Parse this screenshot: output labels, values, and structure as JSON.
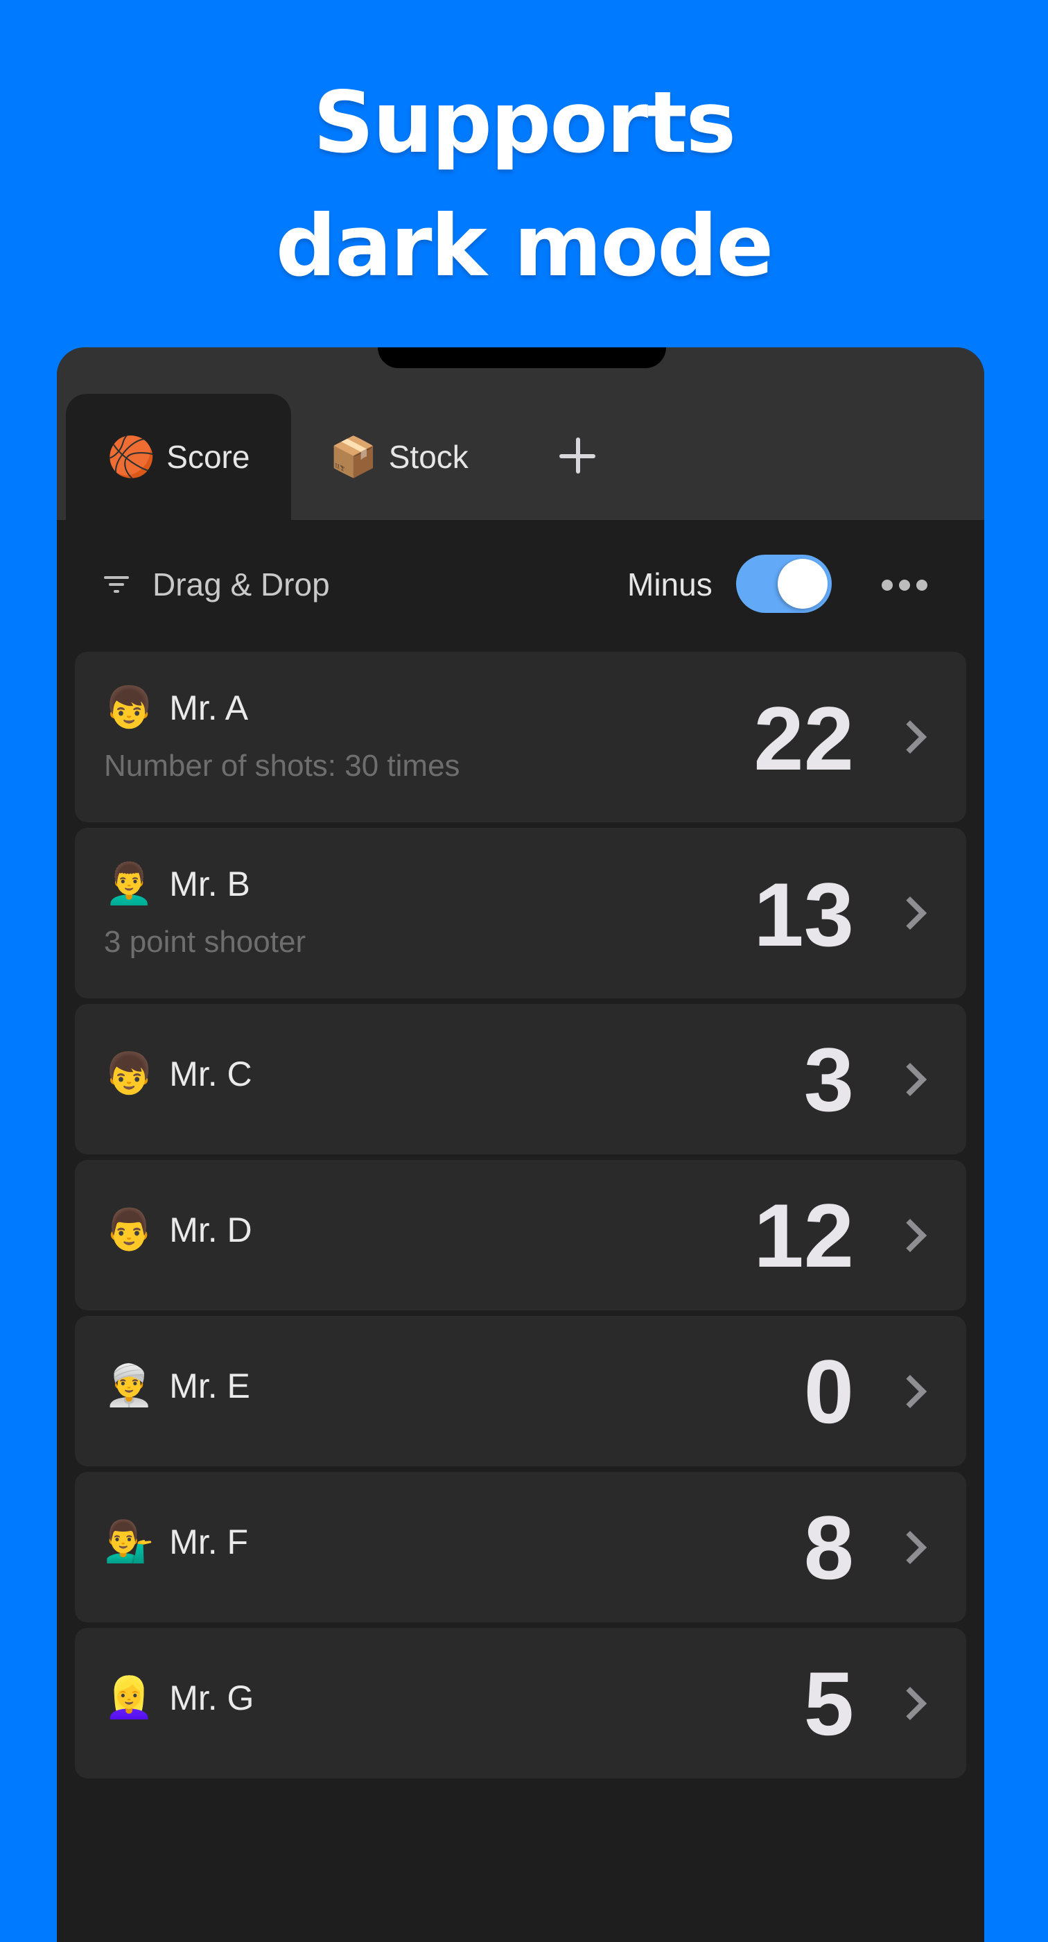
{
  "headline": {
    "line1": "Supports",
    "line2": "dark mode"
  },
  "colors": {
    "background": "#007AFF",
    "toggle_on": "#62A9F7",
    "row_bg": "#2A2A2A",
    "screen_bg": "#1E1E1E",
    "tabbar_bg": "#333333"
  },
  "tabs": [
    {
      "icon": "🏀",
      "icon_name": "basketball-icon",
      "label": "Score",
      "active": true
    },
    {
      "icon": "📦",
      "icon_name": "package-icon",
      "label": "Stock",
      "active": false
    }
  ],
  "add_tab_icon": "plus-icon",
  "toolbar": {
    "sort_icon": "filter-icon",
    "sort_label": "Drag & Drop",
    "minus_label": "Minus",
    "minus_toggle_on": true,
    "more_icon": "ellipsis-icon"
  },
  "players": [
    {
      "avatar": "👦",
      "name": "Mr. A",
      "subtitle": "Number of shots: 30 times",
      "score": "22"
    },
    {
      "avatar": "👨‍🦱",
      "name": "Mr. B",
      "subtitle": "3 point shooter",
      "score": "13"
    },
    {
      "avatar": "👦",
      "name": "Mr. C",
      "subtitle": "",
      "score": "3"
    },
    {
      "avatar": "👨",
      "name": "Mr. D",
      "subtitle": "",
      "score": "12"
    },
    {
      "avatar": "👳‍♂️",
      "name": "Mr. E",
      "subtitle": "",
      "score": "0"
    },
    {
      "avatar": "💁‍♂️",
      "name": "Mr. F",
      "subtitle": "",
      "score": "8"
    },
    {
      "avatar": "👱‍♀️",
      "name": "Mr. G",
      "subtitle": "",
      "score": "5"
    }
  ]
}
